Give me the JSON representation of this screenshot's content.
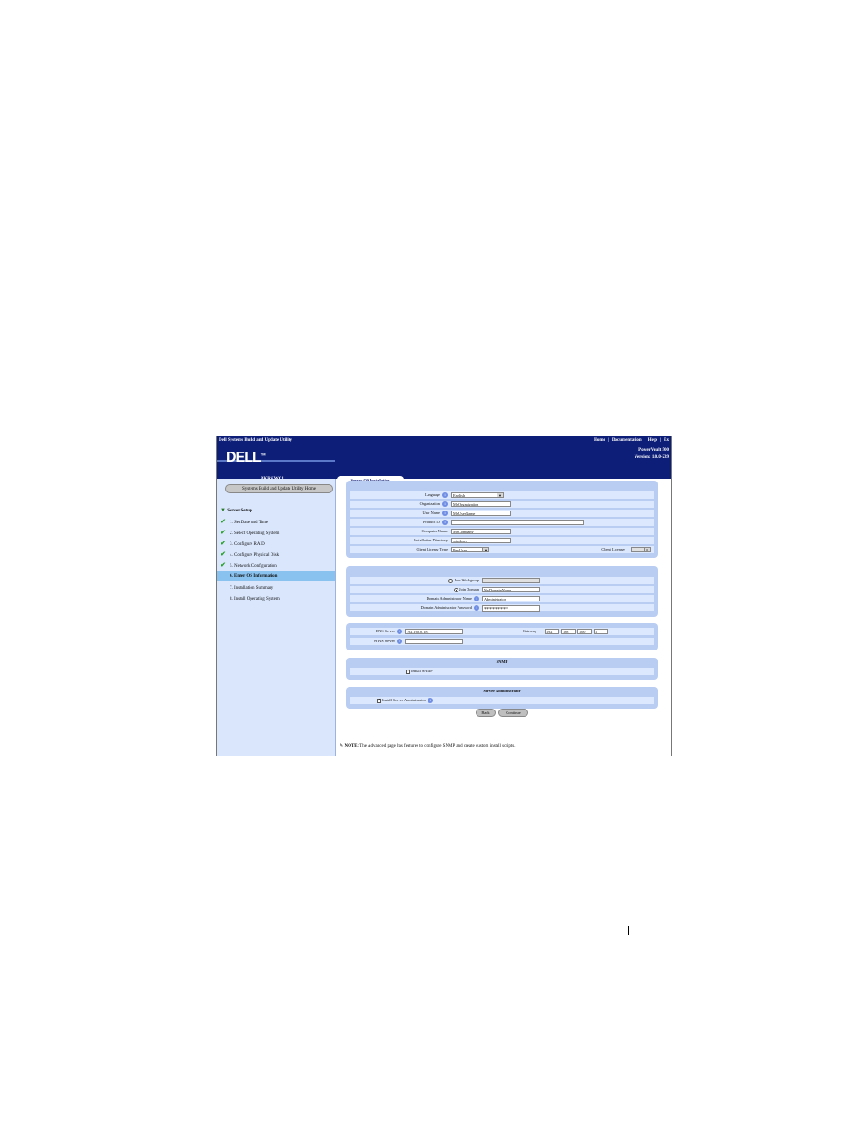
{
  "window": {
    "title": "Dell Systems Build and Update Utility",
    "links": [
      "Home",
      "Documentation",
      "Help",
      "Ex"
    ],
    "logo_text": "DELL",
    "logo_tm": "TM",
    "service_tag": "BKRKWC1",
    "product": "PowerVault 500",
    "version": "Version: 1.0.0-239"
  },
  "tab": {
    "label": "Server OS Installation"
  },
  "sidebar": {
    "home_button": "Systems Build and Update Utility Home",
    "section": "Server Setup",
    "steps": [
      {
        "label": "1. Set Date and Time",
        "done": true
      },
      {
        "label": "2. Select Operating System",
        "done": true
      },
      {
        "label": "3. Configure RAID",
        "done": true
      },
      {
        "label": "4. Configure Physical Disk",
        "done": true
      },
      {
        "label": "5. Network Configuration",
        "done": true
      },
      {
        "label": "6. Enter OS Information",
        "done": false,
        "active": true
      },
      {
        "label": "7. Installation Summary",
        "done": false
      },
      {
        "label": "8. Install Operating System",
        "done": false
      }
    ]
  },
  "os_info": {
    "language_label": "Language",
    "language_value": "English",
    "organization_label": "Organization",
    "organization_value": "MyOrganization",
    "username_label": "User Name",
    "username_value": "MyUserName",
    "productid_label": "Product ID",
    "productid_value": "",
    "computername_label": "Computer Name",
    "computername_value": "MyCompany",
    "installdir_label": "Installation Directory",
    "installdir_value": "windows",
    "licensetype_label": "Client License Type",
    "licensetype_value": "Per-User",
    "clientlicenses_label": "Client Licenses",
    "clientlicenses_value": ""
  },
  "domain": {
    "workgroup_label": "Join Workgroup",
    "domain_label": "Join Domain",
    "domain_value": "MyDomainName",
    "admin_name_label": "Domain Administrator Name",
    "admin_name_value": "Administrator",
    "admin_pwd_label": "Domain Administrator Password",
    "admin_pwd_value": "*********"
  },
  "network": {
    "dns_label": "DNS Server",
    "dns_value": "192.168.0.181",
    "wins_label": "WINS Server",
    "wins_value": "",
    "gateway_label": "Gateway",
    "gateway_octets": [
      "192",
      "168",
      "100",
      "1"
    ]
  },
  "snmp": {
    "title": "SNMP",
    "checkbox_label": "Install SNMP",
    "checked": true
  },
  "server_admin": {
    "title": "Server Administrator",
    "checkbox_label": "Install Server Administrator",
    "checked": true
  },
  "buttons": {
    "back": "Back",
    "continue": "Continue"
  },
  "note": {
    "prefix": "NOTE",
    "text": ": The Advanced page has features to configure SNMP and create custom install scripts."
  },
  "icons": {
    "help": "help-icon",
    "check": "checkmark-icon",
    "note": "note-icon"
  },
  "colors": {
    "header": "#0d1e78",
    "sidebar": "#d9e6fc",
    "panel": "#b9cdf2",
    "row": "#dce8fd",
    "active_step": "#8ac2ef"
  }
}
